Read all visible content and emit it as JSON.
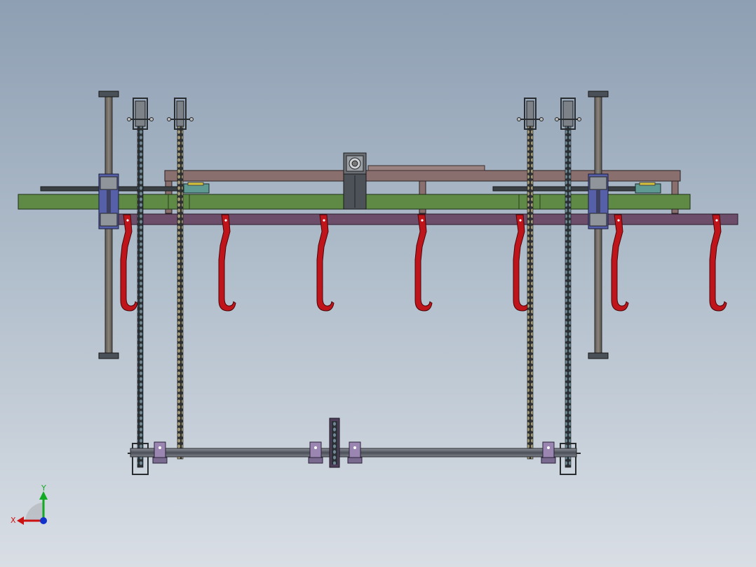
{
  "triad": {
    "x_label": "X",
    "y_label": "Y",
    "x_color": "#cc1111",
    "y_color": "#11aa22",
    "z_color": "#1133cc"
  },
  "colors": {
    "frame": "#8a6f6f",
    "beam_green": "#5f8a45",
    "rail_purple": "#6c4d6a",
    "hook_red": "#c0141b",
    "chain_dark": "#2c3236",
    "post": "#6e6964",
    "bearing_blue": "#5560a8",
    "carriage_gray": "#555a60",
    "shaft": "#5a5e66",
    "bracket_lilac": "#9a86b0",
    "slider_teal": "#5e9a92",
    "accent_yellow": "#d8c43a"
  },
  "icons": {
    "triad": "coordinate-triad-icon"
  }
}
